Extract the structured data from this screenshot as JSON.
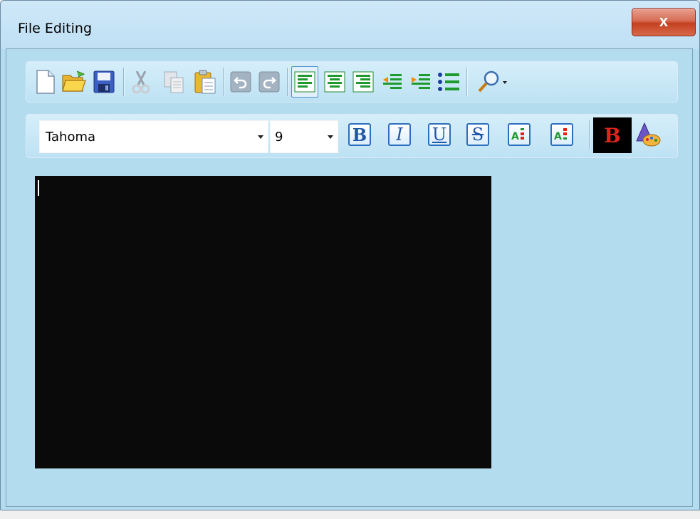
{
  "window": {
    "title": "File Editing",
    "close_glyph": "x"
  },
  "toolbar_main": {
    "buttons": [
      {
        "name": "new-file",
        "icon": "new-document-icon"
      },
      {
        "name": "open-file",
        "icon": "open-folder-icon"
      },
      {
        "name": "save-file",
        "icon": "floppy-disk-icon"
      },
      {
        "name": "cut",
        "icon": "scissors-icon"
      },
      {
        "name": "copy",
        "icon": "copy-icon"
      },
      {
        "name": "paste",
        "icon": "clipboard-paste-icon"
      },
      {
        "name": "undo",
        "icon": "undo-icon"
      },
      {
        "name": "redo",
        "icon": "redo-icon"
      },
      {
        "name": "align-left",
        "icon": "align-left-icon",
        "selected": true
      },
      {
        "name": "align-center",
        "icon": "align-center-icon"
      },
      {
        "name": "align-right",
        "icon": "align-right-icon"
      },
      {
        "name": "outdent",
        "icon": "outdent-icon"
      },
      {
        "name": "indent",
        "icon": "indent-icon"
      },
      {
        "name": "bullets",
        "icon": "bullet-list-icon"
      },
      {
        "name": "find",
        "icon": "magnifier-dropdown-icon"
      }
    ]
  },
  "toolbar_format": {
    "font_family": "Tahoma",
    "font_size": "9",
    "bold_label": "B",
    "italic_label": "I",
    "underline_label": "U",
    "strike_label": "S",
    "text_color_label": "B"
  },
  "colors": {
    "window_bg": "#b4dcef",
    "editor_bg": "#0a0a0a",
    "accent": "#2d6fbc",
    "close_button": "#c4401f",
    "text_color_red": "#e0241c"
  }
}
